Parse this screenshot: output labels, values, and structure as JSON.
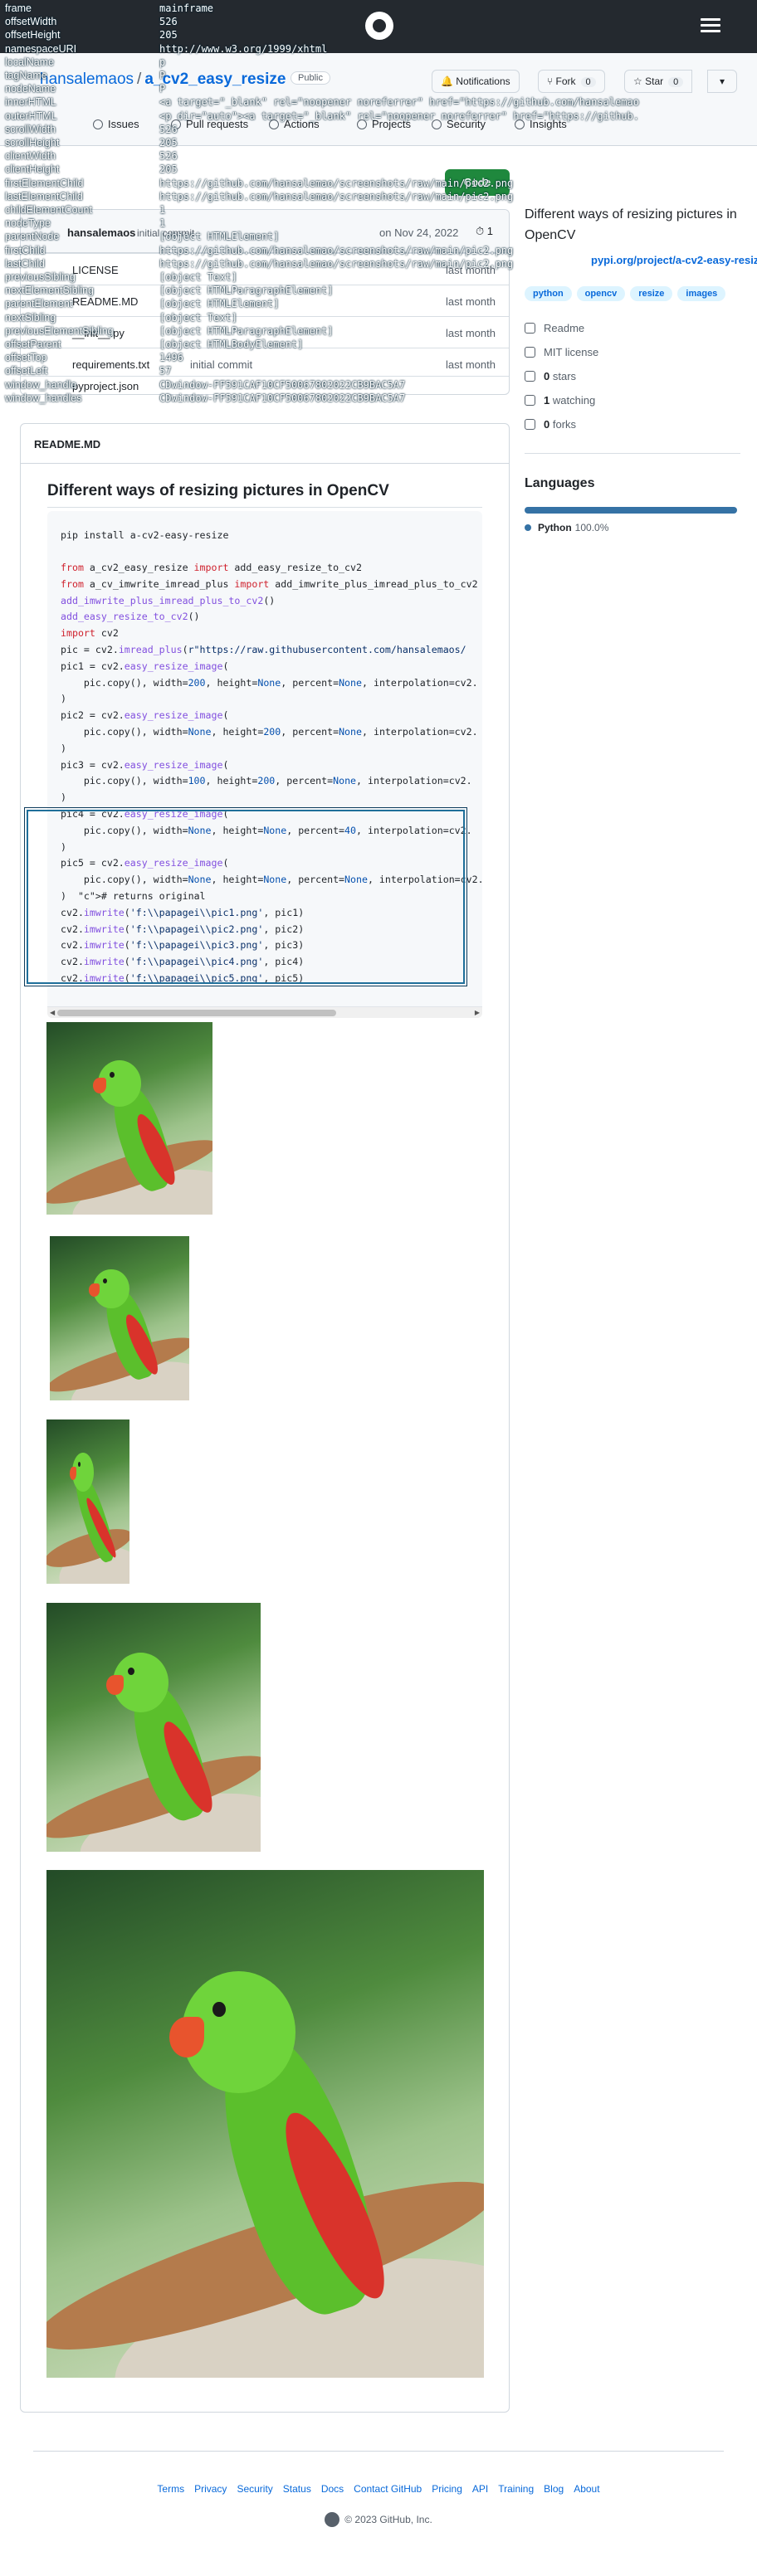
{
  "overlay": {
    "rows": [
      {
        "key": "frame",
        "value": "mainframe"
      },
      {
        "key": "offsetWidth",
        "value": "526"
      },
      {
        "key": "offsetHeight",
        "value": "205"
      },
      {
        "key": "namespaceURI",
        "value": "http://www.w3.org/1999/xhtml"
      },
      {
        "key": "localName",
        "value": "p"
      },
      {
        "key": "tagName",
        "value": "P"
      },
      {
        "key": "nodeName",
        "value": "P"
      },
      {
        "key": "innerHTML",
        "value": "<a target=\"_blank\" rel=\"noopener noreferrer\" href=\"https://github.com/hansalemao"
      },
      {
        "key": "outerHTML",
        "value": "<p dir=\"auto\"><a target=\"_blank\" rel=\"noopener noreferrer\" href=\"https://github."
      },
      {
        "key": "scrollWidth",
        "value": "526"
      },
      {
        "key": "scrollHeight",
        "value": "205"
      },
      {
        "key": "clientWidth",
        "value": "526"
      },
      {
        "key": "clientHeight",
        "value": "205"
      },
      {
        "key": "firstElementChild",
        "value": "https://github.com/hansalemao/screenshots/raw/main/pic2.png"
      },
      {
        "key": "lastElementChild",
        "value": "https://github.com/hansalemao/screenshots/raw/main/pic2.png"
      },
      {
        "key": "childElementCount",
        "value": "1"
      },
      {
        "key": "nodeType",
        "value": "1"
      },
      {
        "key": "parentNode",
        "value": "[object HTMLElement]"
      },
      {
        "key": "firstChild",
        "value": "https://github.com/hansalemao/screenshots/raw/main/pic2.png"
      },
      {
        "key": "lastChild",
        "value": "https://github.com/hansalemao/screenshots/raw/main/pic2.png"
      },
      {
        "key": "previousSibling",
        "value": "[object Text]"
      },
      {
        "key": "nextElementSibling",
        "value": "[object HTMLParagraphElement]"
      },
      {
        "key": "parentElement",
        "value": "[object HTMLElement]"
      },
      {
        "key": "nextSibling",
        "value": "[object Text]"
      },
      {
        "key": "previousElementSibling",
        "value": "[object HTMLParagraphElement]"
      },
      {
        "key": "offsetParent",
        "value": "[object HTMLBodyElement]"
      },
      {
        "key": "offsetTop",
        "value": "1496"
      },
      {
        "key": "offsetLeft",
        "value": "57"
      },
      {
        "key": "window_handle",
        "value": "CDwindow-FF591CAF10CF50067802022CB9BAC5A7"
      },
      {
        "key": "window_handles",
        "value": "CDwindow-FF591CAF10CF50067802022CB9BAC5A7"
      }
    ]
  },
  "header": {
    "owner": "hansalemaos",
    "repo": "a_cv2_easy_resize",
    "visibility": "Public",
    "notifications_label": "Notifications",
    "fork_label": "Fork",
    "fork_count": "0",
    "star_label": "Star",
    "star_count": "0",
    "caret": "▾"
  },
  "tabs": [
    {
      "label": "Issues",
      "icon": "issue-icon"
    },
    {
      "label": "Pull requests",
      "icon": "pull-request-icon"
    },
    {
      "label": "Actions",
      "icon": "actions-icon"
    },
    {
      "label": "Projects",
      "icon": "projects-icon"
    },
    {
      "label": "Security",
      "icon": "security-icon"
    },
    {
      "label": "Insights",
      "icon": "insights-icon"
    }
  ],
  "code_button": "Code",
  "commit": {
    "user": "hansalemaos",
    "message": "initial commit",
    "date": "on Nov 24, 2022",
    "count": "1"
  },
  "files": [
    {
      "name": "LICENSE",
      "message": "",
      "time": "last month"
    },
    {
      "name": "README.MD",
      "message": "",
      "time": "last month"
    },
    {
      "name": "__init__.py",
      "message": "",
      "time": "last month"
    },
    {
      "name": "requirements.txt",
      "message": "initial commit",
      "time": "last month"
    },
    {
      "name": "pyproject.json",
      "message": "",
      "time": ""
    }
  ],
  "about": {
    "description": "Different ways of resizing pictures in OpenCV",
    "link": "pypi.org/project/a-cv2-easy-resize",
    "topics": [
      "python",
      "opencv",
      "resize",
      "images"
    ],
    "readme": "Readme",
    "license": "MIT license",
    "stars_count": "0",
    "stars_label": "stars",
    "watching_count": "1",
    "watching_label": "watching",
    "forks_count": "0",
    "forks_label": "forks"
  },
  "languages": {
    "title": "Languages",
    "items": [
      {
        "name": "Python",
        "percent": "100.0%",
        "color": "#3572A5"
      }
    ]
  },
  "readme": {
    "label": "README.MD",
    "heading": "Different ways of resizing pictures in OpenCV",
    "install_cmd": "pip install a-cv2-easy-resize",
    "code_lines": [
      "from a_cv2_easy_resize import add_easy_resize_to_cv2",
      "from a_cv_imwrite_imread_plus import add_imwrite_plus_imread_plus_to_cv2",
      "add_imwrite_plus_imread_plus_to_cv2()",
      "add_easy_resize_to_cv2()",
      "import cv2",
      "pic = cv2.imread_plus(r\"https://raw.githubusercontent.com/hansalemaos/",
      "pic1 = cv2.easy_resize_image(",
      "    pic.copy(), width=200, height=None, percent=None, interpolation=cv2.",
      ")",
      "pic2 = cv2.easy_resize_image(",
      "    pic.copy(), width=None, height=200, percent=None, interpolation=cv2.",
      ")",
      "pic3 = cv2.easy_resize_image(",
      "    pic.copy(), width=100, height=200, percent=None, interpolation=cv2.",
      ")",
      "pic4 = cv2.easy_resize_image(",
      "    pic.copy(), width=None, height=None, percent=40, interpolation=cv2.",
      ")",
      "pic5 = cv2.easy_resize_image(",
      "    pic.copy(), width=None, height=None, percent=None, interpolation=cv2.",
      ")  # returns original",
      "cv2.imwrite('f:\\\\papagei\\\\pic1.png', pic1)",
      "cv2.imwrite('f:\\\\papagei\\\\pic2.png', pic2)",
      "cv2.imwrite('f:\\\\papagei\\\\pic3.png', pic3)",
      "cv2.imwrite('f:\\\\papagei\\\\pic4.png', pic4)",
      "cv2.imwrite('f:\\\\papagei\\\\pic5.png', pic5)"
    ]
  },
  "footer": {
    "links": [
      "Terms",
      "Privacy",
      "Security",
      "Status",
      "Docs",
      "Contact GitHub",
      "Pricing",
      "API",
      "Training",
      "Blog",
      "About"
    ],
    "copyright": "© 2023 GitHub, Inc."
  },
  "icons": {
    "logo": "github-mark-icon",
    "menu": "hamburger-menu-icon"
  }
}
